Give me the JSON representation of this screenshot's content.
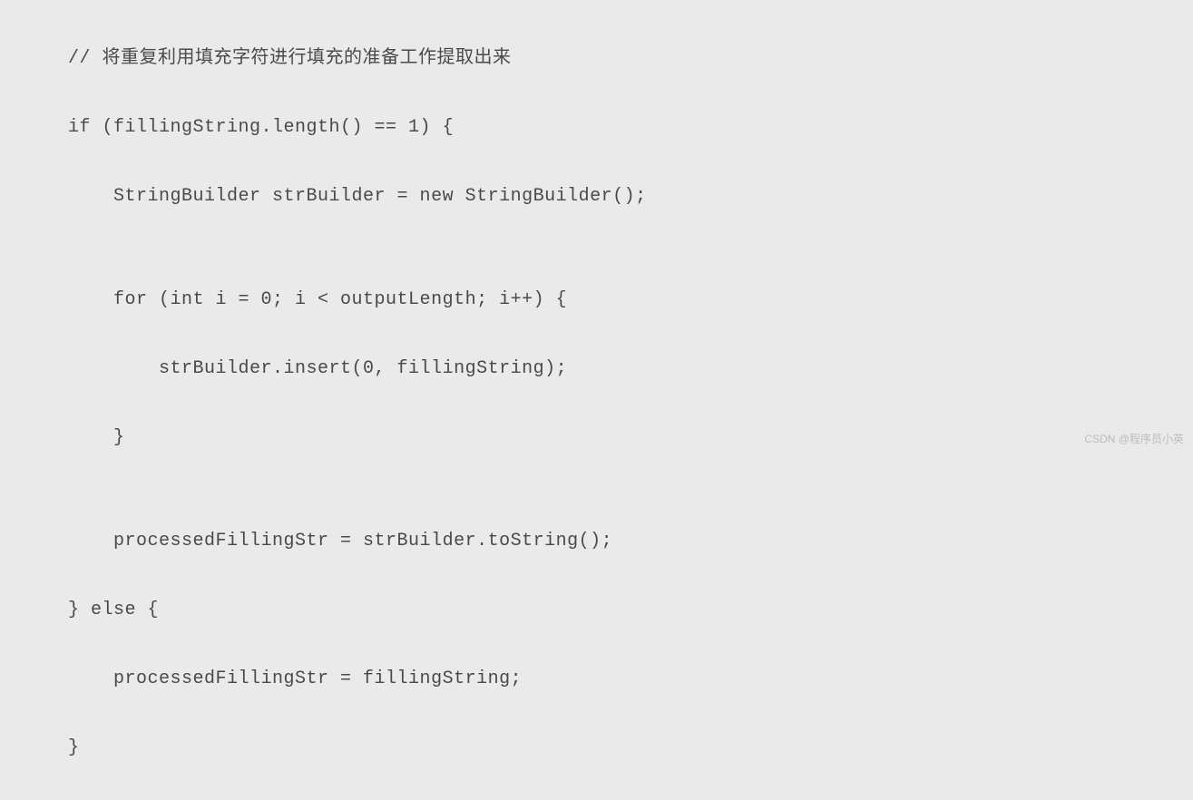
{
  "code": {
    "lines": [
      "// 将重复利用填充字符进行填充的准备工作提取出来",
      "if (fillingString.length() == 1) {",
      "    StringBuilder strBuilder = new StringBuilder();",
      "",
      "    for (int i = 0; i < outputLength; i++) {",
      "        strBuilder.insert(0, fillingString);",
      "    }",
      "",
      "    processedFillingStr = strBuilder.toString();",
      "} else {",
      "    processedFillingStr = fillingString;",
      "}"
    ]
  },
  "watermark": "CSDN @程序员小英"
}
